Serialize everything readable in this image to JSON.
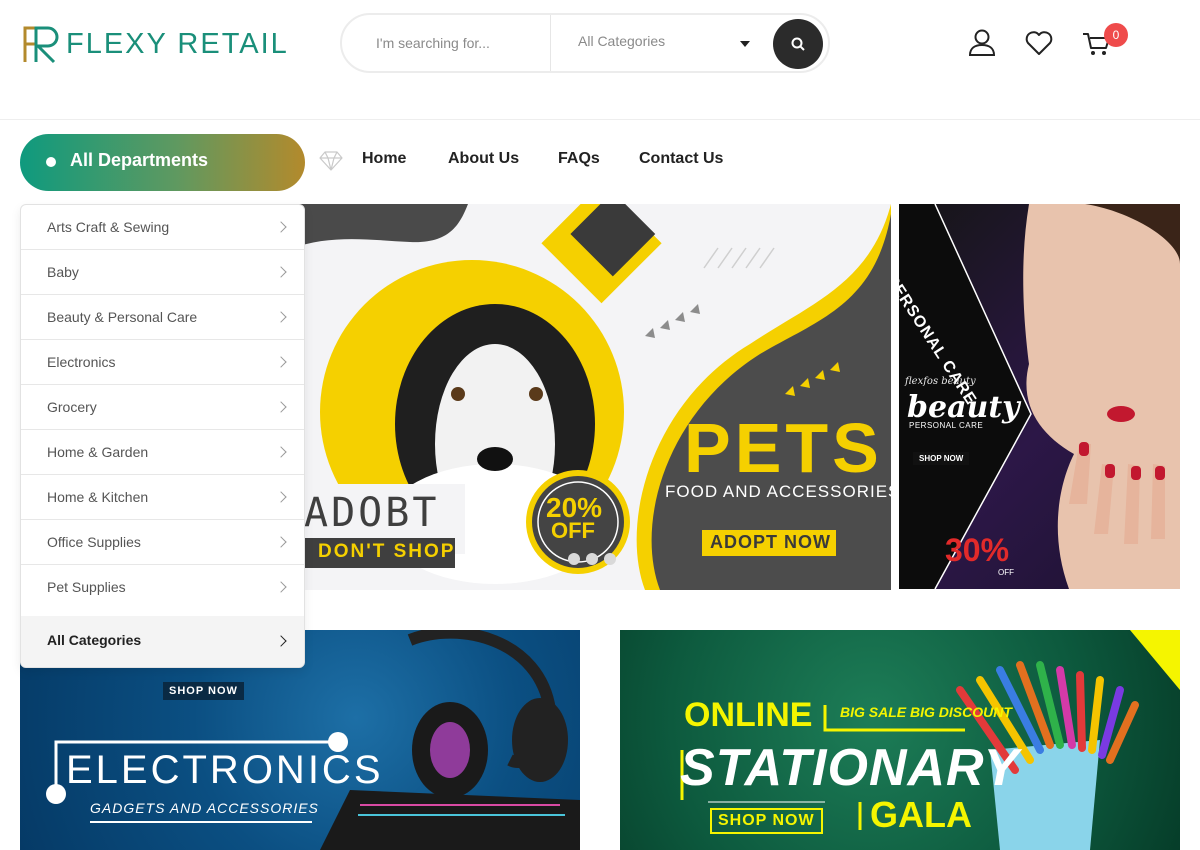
{
  "brand": {
    "name": "FLEXY RETAIL",
    "monogram": "FR",
    "colors": {
      "primary": "#1a8f7a",
      "accent": "#b38a2c"
    }
  },
  "search": {
    "placeholder": "I'm searching for...",
    "category": "All Categories"
  },
  "header_icons": {
    "account": "user-icon",
    "wishlist": "heart-icon",
    "cart": "cart-icon",
    "cart_count": "0"
  },
  "nav": {
    "departments_label": "All Departments",
    "links": [
      "Home",
      "About Us",
      "FAQs",
      "Contact Us"
    ]
  },
  "departments": {
    "items": [
      "Arts Craft & Sewing",
      "Baby",
      "Beauty & Personal Care",
      "Electronics",
      "Grocery",
      "Home & Garden",
      "Home & Kitchen",
      "Office Supplies",
      "Pet Supplies"
    ],
    "all_label": "All Categories"
  },
  "banners": {
    "pets": {
      "adopt": "ADOBT",
      "dont_shop": "DON'T SHOP",
      "discount_big": "20%",
      "discount_small": "OFF",
      "headline": "PETS",
      "sub": "FOOD AND ACCESSORIES",
      "cta": "ADOPT NOW"
    },
    "beauty": {
      "vertical": "PERSONAL CARE",
      "script_top": "flexfos beauty",
      "script": "beauty",
      "sub": "PERSONAL CARE",
      "cta": "SHOP NOW",
      "discount": "30%",
      "off": "OFF"
    },
    "electronics": {
      "cta": "SHOP NOW",
      "headline": "ELECTRONICS",
      "sub": "GADGETS AND ACCESSORIES"
    },
    "stationary": {
      "online": "ONLINE",
      "tag": "BIG SALE BIG DISCOUNT",
      "headline": "STATIONARY",
      "gala": "GALA",
      "cta": "SHOP NOW"
    }
  }
}
